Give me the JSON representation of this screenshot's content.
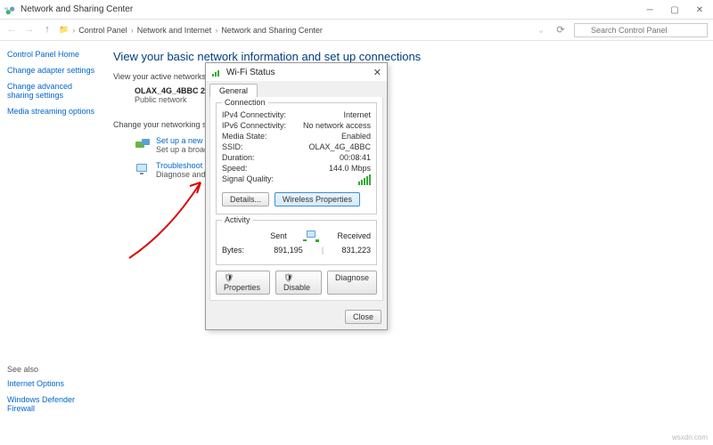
{
  "window": {
    "title": "Network and Sharing Center"
  },
  "breadcrumb": {
    "root": "Control Panel",
    "cat": "Network and Internet",
    "page": "Network and Sharing Center"
  },
  "search": {
    "placeholder": "Search Control Panel"
  },
  "sidebar": {
    "home": "Control Panel Home",
    "items": [
      "Change adapter settings",
      "Change advanced sharing settings",
      "Media streaming options"
    ],
    "see_also_h": "See also",
    "see_also": [
      "Internet Options",
      "Windows Defender Firewall"
    ]
  },
  "content": {
    "heading": "View your basic network information and set up connections",
    "active_h": "View your active networks",
    "network_name": "OLAX_4G_4BBC 2",
    "network_type": "Public network",
    "change_h": "Change your networking settings",
    "setup_link": "Set up a new connection or",
    "setup_desc": "Set up a broadband, dial-up",
    "trouble_link": "Troubleshoot problems",
    "trouble_desc": "Diagnose and repair network"
  },
  "dialog": {
    "title": "Wi-Fi Status",
    "tab": "General",
    "conn_legend": "Connection",
    "rows": {
      "ipv4_k": "IPv4 Connectivity:",
      "ipv4_v": "Internet",
      "ipv6_k": "IPv6 Connectivity:",
      "ipv6_v": "No network access",
      "media_k": "Media State:",
      "media_v": "Enabled",
      "ssid_k": "SSID:",
      "ssid_v": "OLAX_4G_4BBC",
      "dur_k": "Duration:",
      "dur_v": "00:08:41",
      "speed_k": "Speed:",
      "speed_v": "144.0 Mbps",
      "sig_k": "Signal Quality:"
    },
    "details_btn": "Details...",
    "wireless_btn": "Wireless Properties",
    "activity_legend": "Activity",
    "sent": "Sent",
    "received": "Received",
    "bytes_k": "Bytes:",
    "bytes_sent": "891,195",
    "bytes_recv": "831,223",
    "props_btn": "Properties",
    "disable_btn": "Disable",
    "diag_btn": "Diagnose",
    "close_btn": "Close"
  },
  "watermark": "wsxdn.com"
}
